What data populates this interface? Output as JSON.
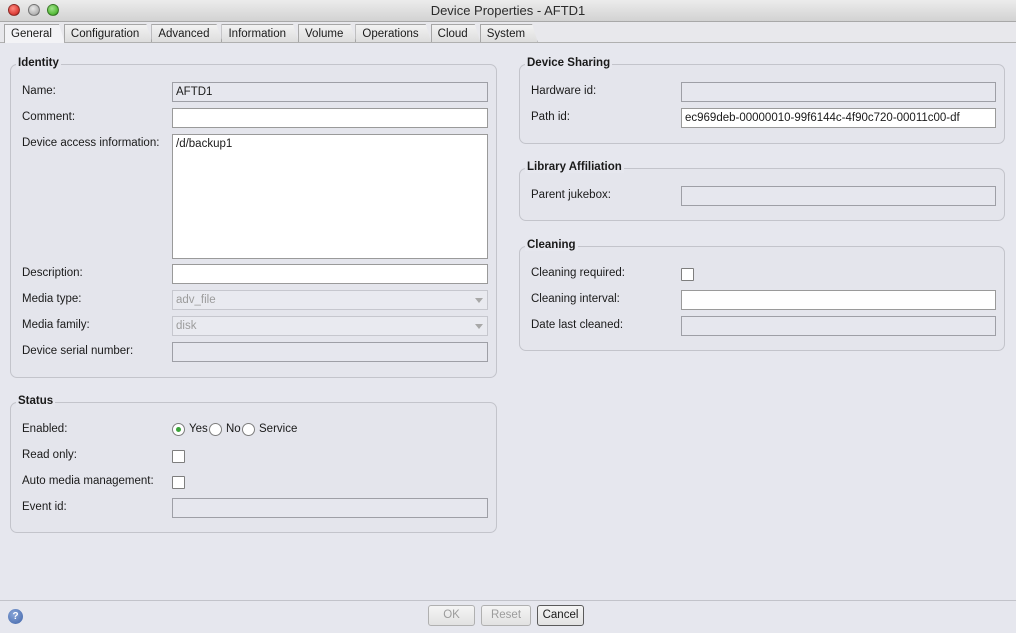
{
  "window": {
    "title": "Device Properties - AFTD1"
  },
  "tabs": [
    {
      "label": "General"
    },
    {
      "label": "Configuration"
    },
    {
      "label": "Advanced"
    },
    {
      "label": "Information"
    },
    {
      "label": "Volume"
    },
    {
      "label": "Operations"
    },
    {
      "label": "Cloud"
    },
    {
      "label": "System"
    }
  ],
  "identity": {
    "legend": "Identity",
    "name_label": "Name:",
    "name_value": "AFTD1",
    "comment_label": "Comment:",
    "comment_value": "",
    "access_label": "Device access information:",
    "access_value": "/d/backup1",
    "description_label": "Description:",
    "description_value": "",
    "media_type_label": "Media type:",
    "media_type_value": "adv_file",
    "media_family_label": "Media family:",
    "media_family_value": "disk",
    "serial_label": "Device serial number:",
    "serial_value": ""
  },
  "status": {
    "legend": "Status",
    "enabled_label": "Enabled:",
    "enabled_options": [
      "Yes",
      "No",
      "Service"
    ],
    "enabled_selected": "Yes",
    "read_only_label": "Read only:",
    "auto_media_label": "Auto media management:",
    "event_id_label": "Event id:",
    "event_id_value": ""
  },
  "sharing": {
    "legend": "Device Sharing",
    "hardware_id_label": "Hardware id:",
    "hardware_id_value": "",
    "path_id_label": "Path id:",
    "path_id_value": "ec969deb-00000010-99f6144c-4f90c720-00011c00-df"
  },
  "library": {
    "legend": "Library Affiliation",
    "parent_label": "Parent jukebox:",
    "parent_value": ""
  },
  "cleaning": {
    "legend": "Cleaning",
    "required_label": "Cleaning required:",
    "interval_label": "Cleaning interval:",
    "interval_value": "",
    "last_cleaned_label": "Date last cleaned:",
    "last_cleaned_value": ""
  },
  "footer": {
    "help_icon": "?",
    "ok_label": "OK",
    "reset_label": "Reset",
    "cancel_label": "Cancel"
  }
}
